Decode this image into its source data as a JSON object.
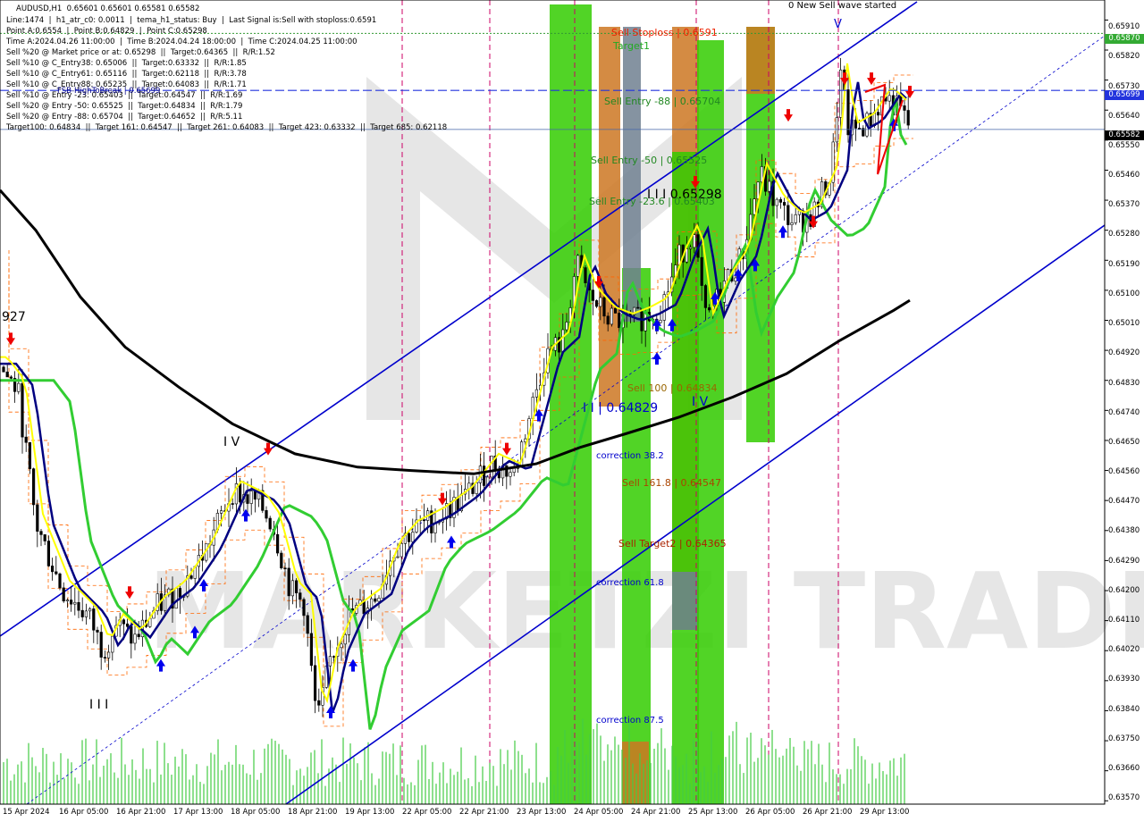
{
  "header": {
    "title": "AUDUSD,H1  0.65601 0.65601 0.65581 0.65582",
    "lines": [
      "Line:1474  |  h1_atr_c0: 0.0011  |  tema_h1_status: Buy  |  Last Signal is:Sell with stoploss:0.6591",
      "Point A:0.6554  |  Point B:0.64829  |  Point C:0.65298",
      "Time A:2024.04.26 11:00:00  |  Time B:2024.04.24 18:00:00  |  Time C:2024.04.25 11:00:00",
      "Sell %20 @ Market price or at: 0.65298  ||  Target:0.64365  ||  R/R:1.52",
      "Sell %10 @ C_Entry38: 0.65006  ||  Target:0.63332  ||  R/R:1.85",
      "Sell %10 @ C_Entry61: 0.65116  ||  Target:0.62118  ||  R/R:3.78",
      "Sell %10 @ C_Entry88: 0.65235  ||  Target:0.64083  ||  R/R:1.71",
      "Sell %10 @ Entry -23: 0.65403  ||  Target:0.64547  ||  R/R:1.69",
      "Sell %20 @ Entry -50: 0.65525  ||  Target:0.64834  ||  R/R:1.79",
      "Sell %20 @ Entry -88: 0.65704  ||  Target:0.64652  ||  R/R:5.11",
      "Target100: 0.64834  ||  Target 161: 0.64547  ||  Target 261: 0.64083  ||  Target 423: 0.63332  ||  Target 685: 0.62118"
    ]
  },
  "colors": {
    "up": "#000000",
    "down": "#000000",
    "ema_fast": "#ffff00",
    "ema_mid": "#000080",
    "ema_slow": "#32cd32",
    "ema_long": "#000000",
    "channel": "#0000cc",
    "zone_green": "#33cc00",
    "zone_orange": "#cc7722",
    "zone_gray": "#708090",
    "sell_arrow": "#ee0000",
    "buy_arrow": "#0000ee",
    "watermark": "#e6e6e6"
  },
  "annotations": {
    "sell_stoploss": "Sell Stoploss | 0.6591",
    "target1": "Target1",
    "sell_entry_88": "Sell Entry -88 | 0.65704",
    "sell_entry_50": "Sell Entry -50 | 0.65525",
    "sell_entry_23": "Sell Entry -23.6 | 0.65403",
    "point_c": "I I I 0.65298",
    "sell_100": "Sell 100 | 0.64834",
    "point_b": "I I | 0.64829",
    "correction_38": "correction 38.2",
    "sell_161": "Sell 161.8 | 0.64547",
    "sell_target2": "Sell Target2 | 0.64365",
    "correction_61": "correction 61.8",
    "correction_87": "correction 87.5",
    "wave_note": "0 New Sell wave started",
    "wave_v": "V",
    "wave_iv_left": "I V",
    "wave_iv_mid": "I V",
    "wave_iii": "I I I",
    "price_927": "927",
    "fsb": "FSB-HighToBreak | 0.65699",
    "watermark": "MARKETZI TRADE"
  },
  "price_levels": {
    "stoploss": 0.6591,
    "target1": 0.6587,
    "entry_88": 0.65699,
    "current": 0.65582
  },
  "chart_data": {
    "type": "candlestick",
    "symbol": "AUDUSD",
    "timeframe": "H1",
    "last_bar": {
      "open": 0.65601,
      "high": 0.65601,
      "low": 0.65581,
      "close": 0.65582
    },
    "y_ticks": [
      0.6591,
      0.6582,
      0.6573,
      0.6564,
      0.6555,
      0.6546,
      0.6537,
      0.6528,
      0.6519,
      0.651,
      0.6501,
      0.6492,
      0.6483,
      0.6474,
      0.6465,
      0.6456,
      0.6447,
      0.6438,
      0.6429,
      0.642,
      0.6411,
      0.6402,
      0.6393,
      0.6384,
      0.6375,
      0.6366,
      0.6357
    ],
    "y_tick_labels": [
      "0.65910",
      "0.65820",
      "0.65730",
      "0.65640",
      "0.65550",
      "0.65460",
      "0.65370",
      "0.65280",
      "0.65190",
      "0.65100",
      "0.65010",
      "0.64920",
      "0.64830",
      "0.64740",
      "0.64650",
      "0.64560",
      "0.64470",
      "0.64380",
      "0.64290",
      "0.64200",
      "0.64110",
      "0.64020",
      "0.63930",
      "0.63840",
      "0.63750",
      "0.63660",
      "0.63570"
    ],
    "x_tick_labels": [
      "15 Apr 2024",
      "16 Apr 05:00",
      "16 Apr 21:00",
      "17 Apr 13:00",
      "18 Apr 05:00",
      "18 Apr 21:00",
      "19 Apr 13:00",
      "22 Apr 05:00",
      "22 Apr 21:00",
      "23 Apr 13:00",
      "24 Apr 05:00",
      "24 Apr 21:00",
      "25 Apr 13:00",
      "26 Apr 05:00",
      "26 Apr 21:00",
      "29 Apr 13:00"
    ],
    "ylim": [
      0.6356,
      0.6597
    ],
    "price_boxes": [
      {
        "label": "0.65870",
        "value": 0.6587,
        "color": "#33aa33"
      },
      {
        "label": "0.65699",
        "value": 0.65699,
        "color": "#2233dd"
      },
      {
        "label": "0.65582",
        "value": 0.65582,
        "color": "#000000"
      }
    ],
    "ema_long_keys": [
      [
        0,
        0.654
      ],
      [
        40,
        0.6528
      ],
      [
        90,
        0.6508
      ],
      [
        140,
        0.6493
      ],
      [
        200,
        0.6481
      ],
      [
        260,
        0.647
      ],
      [
        330,
        0.6461
      ],
      [
        400,
        0.6457
      ],
      [
        460,
        0.6456
      ],
      [
        530,
        0.6455
      ],
      [
        600,
        0.6458
      ],
      [
        650,
        0.6463
      ],
      [
        700,
        0.6467
      ],
      [
        760,
        0.6472
      ],
      [
        820,
        0.6478
      ],
      [
        880,
        0.6485
      ],
      [
        940,
        0.6495
      ],
      [
        1000,
        0.6504
      ],
      [
        1018,
        0.6507
      ]
    ],
    "price_keys": [
      [
        0,
        0.6487
      ],
      [
        20,
        0.648
      ],
      [
        40,
        0.644
      ],
      [
        70,
        0.642
      ],
      [
        100,
        0.6412
      ],
      [
        115,
        0.6402
      ],
      [
        130,
        0.641
      ],
      [
        150,
        0.6405
      ],
      [
        175,
        0.6415
      ],
      [
        200,
        0.642
      ],
      [
        230,
        0.6432
      ],
      [
        260,
        0.645
      ],
      [
        290,
        0.6446
      ],
      [
        305,
        0.644
      ],
      [
        325,
        0.642
      ],
      [
        340,
        0.6416
      ],
      [
        355,
        0.638
      ],
      [
        370,
        0.64
      ],
      [
        390,
        0.6412
      ],
      [
        420,
        0.6418
      ],
      [
        440,
        0.6432
      ],
      [
        460,
        0.6438
      ],
      [
        490,
        0.6442
      ],
      [
        520,
        0.6448
      ],
      [
        550,
        0.6458
      ],
      [
        575,
        0.6455
      ],
      [
        590,
        0.647
      ],
      [
        610,
        0.649
      ],
      [
        630,
        0.6495
      ],
      [
        645,
        0.6518
      ],
      [
        660,
        0.6508
      ],
      [
        680,
        0.6502
      ],
      [
        700,
        0.65
      ],
      [
        720,
        0.6502
      ],
      [
        740,
        0.6505
      ],
      [
        760,
        0.652
      ],
      [
        775,
        0.6528
      ],
      [
        790,
        0.65
      ],
      [
        810,
        0.6512
      ],
      [
        830,
        0.652
      ],
      [
        850,
        0.6545
      ],
      [
        870,
        0.6535
      ],
      [
        890,
        0.653
      ],
      [
        910,
        0.6533
      ],
      [
        930,
        0.6545
      ],
      [
        940,
        0.6575
      ],
      [
        950,
        0.6557
      ],
      [
        970,
        0.656
      ],
      [
        990,
        0.6568
      ],
      [
        1010,
        0.6563
      ],
      [
        1018,
        0.6558
      ]
    ]
  }
}
